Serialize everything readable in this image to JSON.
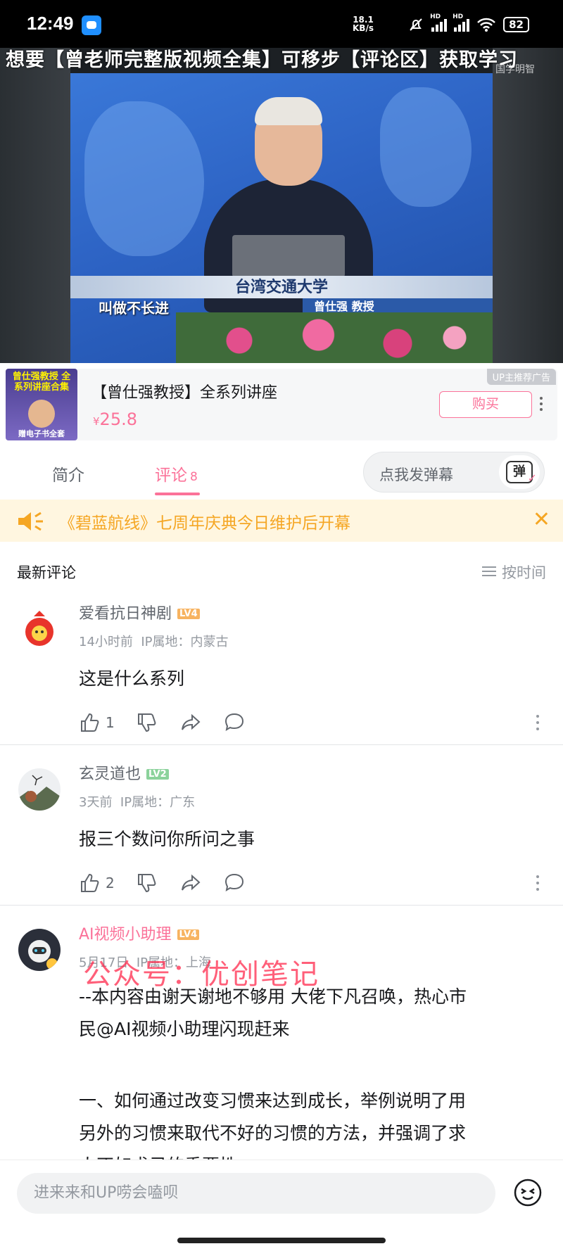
{
  "status_bar": {
    "time": "12:49",
    "net_speed": "18.1",
    "net_unit": "KB/s",
    "signal_label": "HD",
    "battery": "82"
  },
  "video": {
    "ad_banner": "想要【曾老师完整版视频全集】可移步【评论区】获取学习",
    "watermark": "国学明智",
    "stage_banner": "台湾交通大学",
    "nameplate": "曾仕强  教授",
    "subtitle": "叫做不长进"
  },
  "product": {
    "thumb_title": "曾仕强教授 全系列讲座合集",
    "thumb_bottom": "赠电子书全套",
    "title": "【曾仕强教授】全系列讲座",
    "price_symbol": "¥",
    "price": "25.8",
    "buy_label": "购买",
    "ad_tag": "UP主推荐广告"
  },
  "tabs": {
    "intro": "简介",
    "comments": "评论",
    "comments_count": "8",
    "danmaku_placeholder": "点我发弹幕",
    "danmaku_icon": "弹"
  },
  "notice": {
    "text": "《碧蓝航线》七周年庆典今日维护后开幕"
  },
  "comments_header": {
    "label": "最新评论",
    "sort": "按时间"
  },
  "comments": [
    {
      "user": "爱看抗日神剧",
      "level": "LV4",
      "level_color": "#f7b360",
      "time": "14小时前",
      "location": "IP属地：内蒙古",
      "text": "这是什么系列",
      "likes": "1"
    },
    {
      "user": "玄灵道也",
      "level": "LV2",
      "level_color": "#8bd29b",
      "time": "3天前",
      "location": "IP属地：广东",
      "text": "报三个数问你所问之事",
      "likes": "2"
    },
    {
      "user": "AI视频小助理",
      "level": "LV4",
      "level_color": "#f7b360",
      "time": "5月17日",
      "location": "IP属地：上海",
      "text_lines": [
        "--本内容由谢天谢地不够用 大佬下凡召唤，热心市",
        "民@AI视频小助理闪现赶来",
        "",
        "一、如何通过改变习惯来达到成长，举例说明了用",
        "另外的习惯来取代不好的习惯的方法，并强调了求",
        "人不如求己的重要性"
      ]
    }
  ],
  "overlay_watermark": "公众号：优创笔记",
  "bottom_bar": {
    "reply_placeholder": "进来来和UP唠会嗑呗"
  },
  "colors": {
    "accent": "#fb7299",
    "notice": "#f5a623",
    "status_bar": "#000000"
  }
}
